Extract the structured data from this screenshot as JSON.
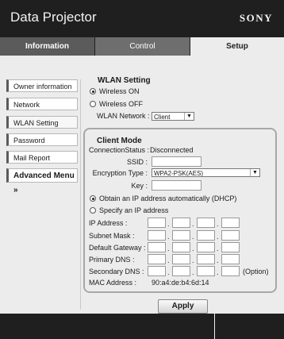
{
  "header": {
    "title": "Data Projector",
    "brand": "SONY"
  },
  "tabs": [
    {
      "label": "Information"
    },
    {
      "label": "Control"
    },
    {
      "label": "Setup"
    }
  ],
  "sidebar": {
    "items": [
      {
        "label": "Owner information"
      },
      {
        "label": "Network"
      },
      {
        "label": "WLAN Setting"
      },
      {
        "label": "Password"
      },
      {
        "label": "Mail Report"
      },
      {
        "label": "Advanced Menu »"
      }
    ]
  },
  "wlan": {
    "title": "WLAN Setting",
    "wireless_on": "Wireless ON",
    "wireless_off": "Wireless OFF",
    "network_label": "WLAN Network :",
    "network_value": "Client"
  },
  "client": {
    "title": "Client Mode",
    "status_label": "ConnectionStatus :",
    "status_value": "Disconnected",
    "ssid_label": "SSID :",
    "ssid_value": "",
    "enc_label": "Encryption Type :",
    "enc_value": "WPA2-PSK(AES)",
    "key_label": "Key :",
    "key_value": "",
    "dhcp_label": "Obtain an IP address automatically (DHCP)",
    "static_label": "Specify an IP address",
    "fields": [
      {
        "label": "IP Address :"
      },
      {
        "label": "Subnet Mask :"
      },
      {
        "label": "Default Gateway :"
      },
      {
        "label": "Primary DNS :"
      },
      {
        "label": "Secondary DNS :"
      }
    ],
    "option_label": "(Option)",
    "mac_label": "MAC Address :",
    "mac_value": "90:a4:de:b4:6d:14"
  },
  "apply_label": "Apply"
}
